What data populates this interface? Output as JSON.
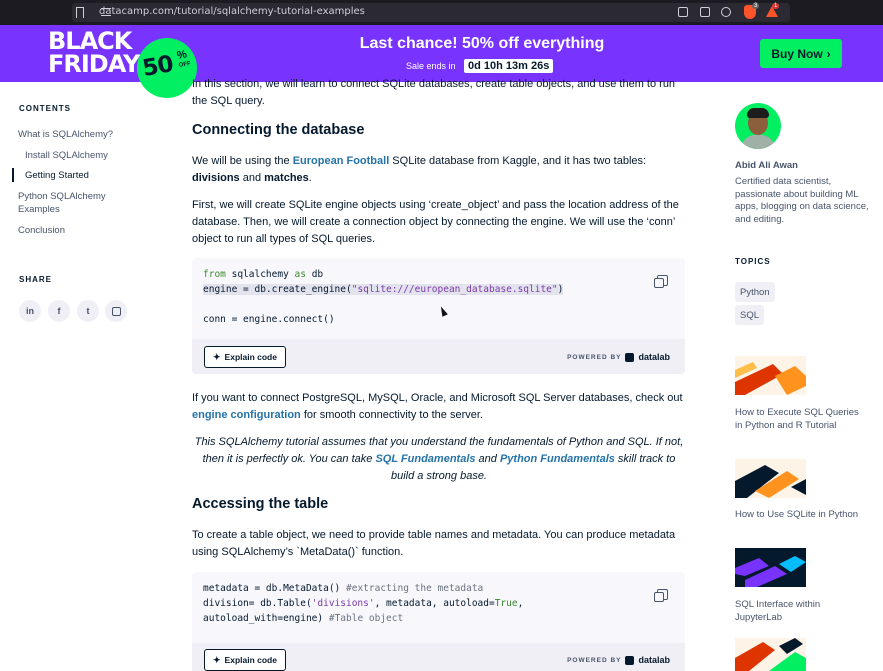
{
  "browser": {
    "url": "datacamp.com/tutorial/sqlalchemy-tutorial-examples",
    "brave_badge": "3",
    "rewards_badge": "1"
  },
  "promo": {
    "black": "BLACK",
    "friday": "FRIDAY",
    "badge_pct": "50",
    "badge_sym": "%",
    "badge_off": "OFF",
    "title": "Last chance! 50% off everything",
    "sale_ends": "Sale ends in",
    "countdown": "0d 10h 13m 26s",
    "buy_label": "Buy Now",
    "buy_arrow": "›",
    "colors": {
      "banner": "#7933ff",
      "accent": "#03ef62"
    }
  },
  "toc": {
    "title": "CONTENTS",
    "items": [
      {
        "label": "What is SQLAlchemy?"
      },
      {
        "label": "Install SQLAlchemy"
      },
      {
        "label": "Getting Started"
      },
      {
        "label": "Python SQLAlchemy Examples"
      },
      {
        "label": "Conclusion"
      }
    ]
  },
  "share": {
    "title": "SHARE",
    "linkedin": "in",
    "facebook": "f",
    "twitter": "t"
  },
  "article": {
    "intro": "In this section, we will learn to connect SQLite databases, create table objects, and use them to run the SQL query.",
    "h_connect": "Connecting the database",
    "p1_a": "We will be using the ",
    "p1_link": "European Football",
    "p1_b": " SQLite database from Kaggle, and it has two tables: ",
    "p1_bold1": "divisions",
    "p1_c": " and ",
    "p1_bold2": "matches",
    "p1_d": ".",
    "p2": "First, we will create SQLite engine objects using ‘create_object’ and pass the location address of the database. Then, we will create a connection object by connecting the engine. We will use the ‘conn’ object to run all types of SQL queries.",
    "code1": {
      "l1_kw1": "from",
      "l1_mod": " sqlalchemy ",
      "l1_kw2": "as",
      "l1_alias": " db",
      "l2_a": "engine = db.create_engine(",
      "l2_str": "\"sqlite:///european_database.sqlite\"",
      "l2_b": ")",
      "l3": "conn = engine.connect()"
    },
    "explain_label": "Explain code",
    "powered_label": "POWERED BY",
    "powered_brand": "datalab",
    "p3_a": "If you want to connect PostgreSQL, MySQL, Oracle, and Microsoft SQL Server databases, check out ",
    "p3_link": "engine configuration",
    "p3_b": " for smooth connectivity to the server.",
    "quote_a": "This SQLAlchemy tutorial assumes that you understand the fundamentals of Python and SQL. If not, then it is perfectly ok. You can take ",
    "quote_link1": "SQL Fundamentals",
    "quote_b": " and ",
    "quote_link2": "Python Fundamentals",
    "quote_c": " skill track to build a strong base.",
    "h_access": "Accessing the table",
    "p4": "To create a table object, we need to provide table names and metadata. You can produce metadata using SQLAlchemy’s `MetaData()` function.",
    "code2": {
      "l1_a": "metadata = db.MetaData() ",
      "l1_cmt": "#extracting the metadata",
      "l2_a": "division= db.Table(",
      "l2_str": "'divisions'",
      "l2_b": ", metadata, autoload=",
      "l2_kw": "True",
      "l2_c": ",",
      "l3_a": "autoload_with=engine) ",
      "l3_cmt": "#Table object"
    }
  },
  "author": {
    "name": "Abid Ali Awan",
    "bio": "Certified data scientist, passionate about building ML apps, blogging on data science, and editing."
  },
  "topics": {
    "title": "TOPICS",
    "items": [
      "Python",
      "SQL"
    ]
  },
  "related": [
    {
      "title": "How to Execute SQL Queries in Python and R Tutorial"
    },
    {
      "title": "How to Use SQLite in Python"
    },
    {
      "title": "SQL Interface within JupyterLab"
    }
  ]
}
